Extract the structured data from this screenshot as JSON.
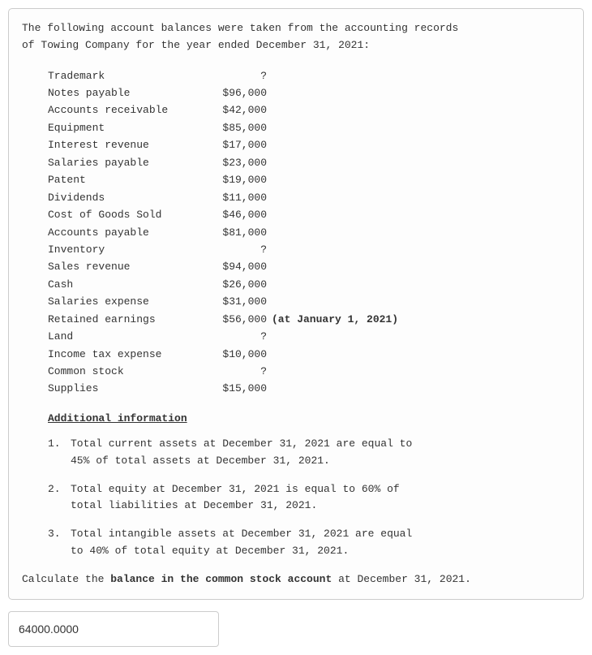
{
  "intro_line1": "The following account balances were taken from the accounting records",
  "intro_line2": "of Towing Company for the year ended December 31, 2021:",
  "accounts": [
    {
      "label": "Trademark",
      "value": "?",
      "note": ""
    },
    {
      "label": "Notes payable",
      "value": "$96,000",
      "note": ""
    },
    {
      "label": "Accounts receivable",
      "value": "$42,000",
      "note": ""
    },
    {
      "label": "Equipment",
      "value": "$85,000",
      "note": ""
    },
    {
      "label": "Interest revenue",
      "value": "$17,000",
      "note": ""
    },
    {
      "label": "Salaries payable",
      "value": "$23,000",
      "note": ""
    },
    {
      "label": "Patent",
      "value": "$19,000",
      "note": ""
    },
    {
      "label": "Dividends",
      "value": "$11,000",
      "note": ""
    },
    {
      "label": "Cost of Goods Sold",
      "value": "$46,000",
      "note": ""
    },
    {
      "label": "Accounts payable",
      "value": "$81,000",
      "note": ""
    },
    {
      "label": "Inventory",
      "value": "?",
      "note": ""
    },
    {
      "label": "Sales revenue",
      "value": "$94,000",
      "note": ""
    },
    {
      "label": "Cash",
      "value": "$26,000",
      "note": ""
    },
    {
      "label": "Salaries expense",
      "value": "$31,000",
      "note": ""
    },
    {
      "label": "Retained earnings",
      "value": "$56,000",
      "note": "(at January 1, 2021)"
    },
    {
      "label": "Land",
      "value": "?",
      "note": ""
    },
    {
      "label": "Income tax expense",
      "value": "$10,000",
      "note": ""
    },
    {
      "label": "Common stock",
      "value": "?",
      "note": ""
    },
    {
      "label": "Supplies",
      "value": "$15,000",
      "note": ""
    }
  ],
  "subheading": "Additional information",
  "info_items": [
    {
      "num": "1.",
      "text": "Total current assets at December 31, 2021 are equal to 45% of total assets at December 31, 2021."
    },
    {
      "num": "2.",
      "text": "Total equity at December 31, 2021 is equal to 60% of total liabilities at December 31, 2021."
    },
    {
      "num": "3.",
      "text": "Total intangible assets at December 31, 2021 are equal to 40% of total equity at December 31, 2021."
    }
  ],
  "final_pre": "Calculate the ",
  "final_bold": "balance in the common stock account",
  "final_post": " at December 31, 2021.",
  "answer_value": "64000.0000"
}
